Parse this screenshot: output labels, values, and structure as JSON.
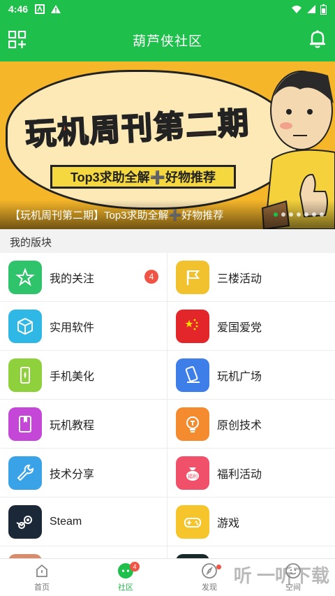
{
  "status": {
    "time": "4:46"
  },
  "header": {
    "title": "葫芦侠社区"
  },
  "banner": {
    "headline": "玩机周刊第二期",
    "subtitle": "Top3求助全解➕好物推荐",
    "caption": "【玩机周刊第二期】Top3求助全解➕好物推荐",
    "dot_count": 7,
    "active_dot": 0
  },
  "section": {
    "title": "我的版块"
  },
  "boards": [
    {
      "label": "我的关注",
      "icon": "star-icon",
      "color": "#2fc46b",
      "badge": "4"
    },
    {
      "label": "三楼活动",
      "icon": "flag-icon",
      "color": "#f2c12e",
      "badge": ""
    },
    {
      "label": "实用软件",
      "icon": "cube-icon",
      "color": "#2fb7e5",
      "badge": ""
    },
    {
      "label": "爱国爱党",
      "icon": "china-flag-icon",
      "color": "#e3262a",
      "badge": ""
    },
    {
      "label": "手机美化",
      "icon": "phone-beautify-icon",
      "color": "#8fd13d",
      "badge": ""
    },
    {
      "label": "玩机广场",
      "icon": "phone-pen-icon",
      "color": "#3d7ee8",
      "badge": ""
    },
    {
      "label": "玩机教程",
      "icon": "book-icon",
      "color": "#c547d8",
      "badge": ""
    },
    {
      "label": "原创技术",
      "icon": "bulb-icon",
      "color": "#f48b2e",
      "badge": ""
    },
    {
      "label": "技术分享",
      "icon": "wrench-icon",
      "color": "#3aa3e8",
      "badge": ""
    },
    {
      "label": "福利活动",
      "icon": "gift-bag-icon",
      "color": "#f0506a",
      "badge": ""
    },
    {
      "label": "Steam",
      "icon": "steam-icon",
      "color": "#1b2838",
      "badge": ""
    },
    {
      "label": "游戏",
      "icon": "gamepad-icon",
      "color": "#f5c52b",
      "badge": ""
    },
    {
      "label": "",
      "icon": "partial-icon",
      "color": "#d98b6a",
      "badge": ""
    },
    {
      "label": "",
      "icon": "partial-icon",
      "color": "#1a2a2a",
      "badge": ""
    }
  ],
  "tabs": [
    {
      "label": "首页",
      "icon": "home-icon",
      "active": false,
      "badge": ""
    },
    {
      "label": "社区",
      "icon": "community-icon",
      "active": true,
      "badge": "4"
    },
    {
      "label": "发现",
      "icon": "compass-icon",
      "active": false,
      "badge": ""
    },
    {
      "label": "空间",
      "icon": "profile-icon",
      "active": false,
      "badge": ""
    }
  ],
  "watermark": "听 一听下载"
}
